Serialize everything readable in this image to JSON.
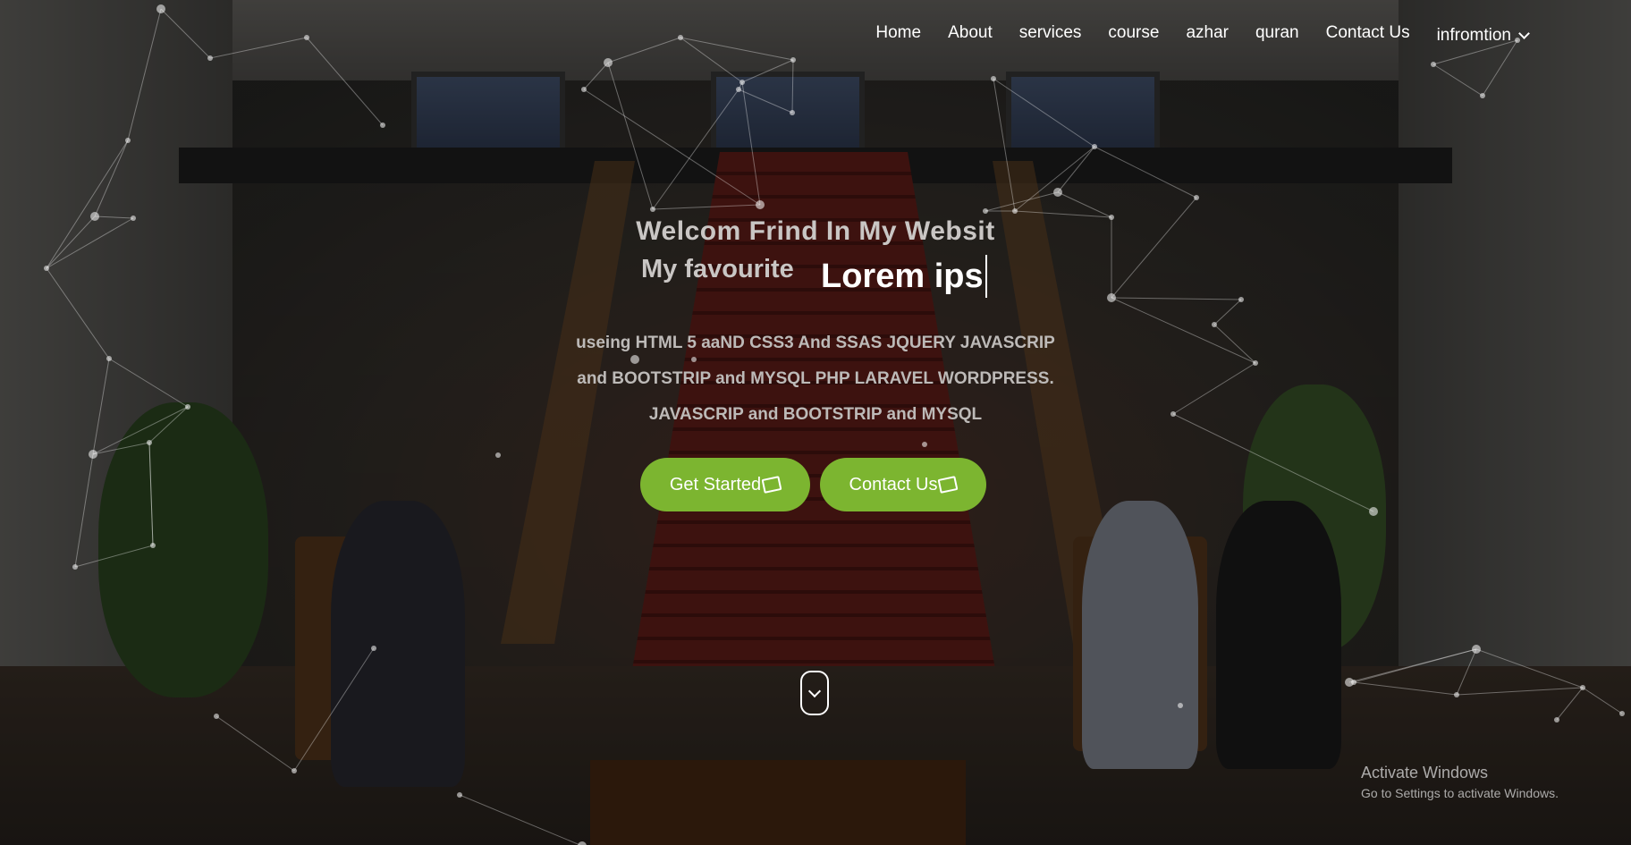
{
  "nav": {
    "items": [
      "Home",
      "About",
      "services",
      "course",
      "azhar",
      "quran",
      "Contact Us"
    ],
    "dropdown_label": "infromtion"
  },
  "hero": {
    "headline": "Welcom Frind In My Websit",
    "favourite_prefix": "My favourite",
    "typed_text": "Lorem ips",
    "description_lines": [
      "useing HTML 5 aaND CSS3 And SSAS JQUERY JAVASCRIP",
      "and BOOTSTRIP and MYSQL PHP LARAVEL WORDPRESS.",
      "JAVASCRIP and BOOTSTRIP and MYSQL"
    ],
    "primary_button": "Get Started",
    "secondary_button": "Contact Us",
    "button_color": "#7cb530"
  },
  "watermark": {
    "title": "Activate Windows",
    "subtitle": "Go to Settings to activate Windows."
  },
  "icons": {
    "dropdown": "chevron-down-icon",
    "button": "hand-icon",
    "scroll": "chevron-down-icon"
  }
}
